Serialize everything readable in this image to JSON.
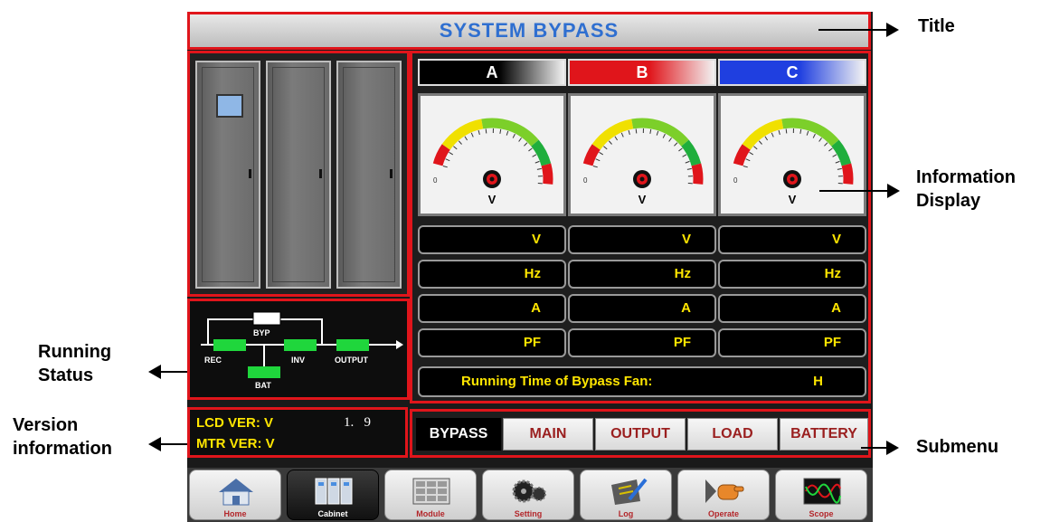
{
  "title": "SYSTEM BYPASS",
  "phases": [
    {
      "label": "A",
      "color": "#000000"
    },
    {
      "label": "B",
      "color": "#e0151b"
    },
    {
      "label": "C",
      "color": "#1f3fe0"
    }
  ],
  "gauge": {
    "zero_label": "0",
    "unit": "V"
  },
  "readings": {
    "rows": [
      "V",
      "Hz",
      "A",
      "PF"
    ]
  },
  "running_time": {
    "label": "Running Time of Bypass Fan:",
    "unit": "H"
  },
  "status_diagram": {
    "byp": "BYP",
    "rec": "REC",
    "inv": "INV",
    "output": "OUTPUT",
    "bat": "BAT"
  },
  "version": {
    "lcd": "LCD VER: V",
    "lcd_number": "1.   9",
    "mtr": "MTR VER: V"
  },
  "submenu": {
    "items": [
      "BYPASS",
      "MAIN",
      "OUTPUT",
      "LOAD",
      "BATTERY"
    ],
    "active": "BYPASS"
  },
  "nav": {
    "items": [
      "Home",
      "Cabinet",
      "Module",
      "Setting",
      "Log",
      "Operate",
      "Scope"
    ],
    "active": "Cabinet"
  },
  "callouts": {
    "title": "Title",
    "info_line1": "Information",
    "info_line2": "Display",
    "running_line1": "Running",
    "running_line2": "Status",
    "version_line1": "Version",
    "version_line2": "information",
    "submenu": "Submenu"
  }
}
